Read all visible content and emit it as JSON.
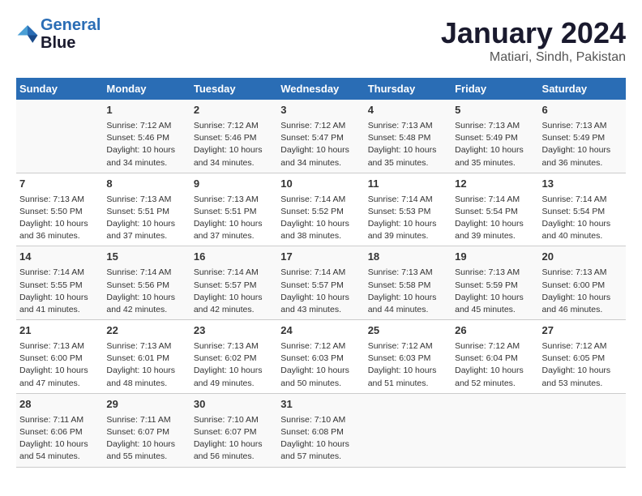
{
  "header": {
    "logo_line1": "General",
    "logo_line2": "Blue",
    "month": "January 2024",
    "location": "Matiari, Sindh, Pakistan"
  },
  "days_of_week": [
    "Sunday",
    "Monday",
    "Tuesday",
    "Wednesday",
    "Thursday",
    "Friday",
    "Saturday"
  ],
  "weeks": [
    [
      {
        "day": "",
        "info": ""
      },
      {
        "day": "1",
        "info": "Sunrise: 7:12 AM\nSunset: 5:46 PM\nDaylight: 10 hours\nand 34 minutes."
      },
      {
        "day": "2",
        "info": "Sunrise: 7:12 AM\nSunset: 5:46 PM\nDaylight: 10 hours\nand 34 minutes."
      },
      {
        "day": "3",
        "info": "Sunrise: 7:12 AM\nSunset: 5:47 PM\nDaylight: 10 hours\nand 34 minutes."
      },
      {
        "day": "4",
        "info": "Sunrise: 7:13 AM\nSunset: 5:48 PM\nDaylight: 10 hours\nand 35 minutes."
      },
      {
        "day": "5",
        "info": "Sunrise: 7:13 AM\nSunset: 5:49 PM\nDaylight: 10 hours\nand 35 minutes."
      },
      {
        "day": "6",
        "info": "Sunrise: 7:13 AM\nSunset: 5:49 PM\nDaylight: 10 hours\nand 36 minutes."
      }
    ],
    [
      {
        "day": "7",
        "info": "Sunrise: 7:13 AM\nSunset: 5:50 PM\nDaylight: 10 hours\nand 36 minutes."
      },
      {
        "day": "8",
        "info": "Sunrise: 7:13 AM\nSunset: 5:51 PM\nDaylight: 10 hours\nand 37 minutes."
      },
      {
        "day": "9",
        "info": "Sunrise: 7:13 AM\nSunset: 5:51 PM\nDaylight: 10 hours\nand 37 minutes."
      },
      {
        "day": "10",
        "info": "Sunrise: 7:14 AM\nSunset: 5:52 PM\nDaylight: 10 hours\nand 38 minutes."
      },
      {
        "day": "11",
        "info": "Sunrise: 7:14 AM\nSunset: 5:53 PM\nDaylight: 10 hours\nand 39 minutes."
      },
      {
        "day": "12",
        "info": "Sunrise: 7:14 AM\nSunset: 5:54 PM\nDaylight: 10 hours\nand 39 minutes."
      },
      {
        "day": "13",
        "info": "Sunrise: 7:14 AM\nSunset: 5:54 PM\nDaylight: 10 hours\nand 40 minutes."
      }
    ],
    [
      {
        "day": "14",
        "info": "Sunrise: 7:14 AM\nSunset: 5:55 PM\nDaylight: 10 hours\nand 41 minutes."
      },
      {
        "day": "15",
        "info": "Sunrise: 7:14 AM\nSunset: 5:56 PM\nDaylight: 10 hours\nand 42 minutes."
      },
      {
        "day": "16",
        "info": "Sunrise: 7:14 AM\nSunset: 5:57 PM\nDaylight: 10 hours\nand 42 minutes."
      },
      {
        "day": "17",
        "info": "Sunrise: 7:14 AM\nSunset: 5:57 PM\nDaylight: 10 hours\nand 43 minutes."
      },
      {
        "day": "18",
        "info": "Sunrise: 7:13 AM\nSunset: 5:58 PM\nDaylight: 10 hours\nand 44 minutes."
      },
      {
        "day": "19",
        "info": "Sunrise: 7:13 AM\nSunset: 5:59 PM\nDaylight: 10 hours\nand 45 minutes."
      },
      {
        "day": "20",
        "info": "Sunrise: 7:13 AM\nSunset: 6:00 PM\nDaylight: 10 hours\nand 46 minutes."
      }
    ],
    [
      {
        "day": "21",
        "info": "Sunrise: 7:13 AM\nSunset: 6:00 PM\nDaylight: 10 hours\nand 47 minutes."
      },
      {
        "day": "22",
        "info": "Sunrise: 7:13 AM\nSunset: 6:01 PM\nDaylight: 10 hours\nand 48 minutes."
      },
      {
        "day": "23",
        "info": "Sunrise: 7:13 AM\nSunset: 6:02 PM\nDaylight: 10 hours\nand 49 minutes."
      },
      {
        "day": "24",
        "info": "Sunrise: 7:12 AM\nSunset: 6:03 PM\nDaylight: 10 hours\nand 50 minutes."
      },
      {
        "day": "25",
        "info": "Sunrise: 7:12 AM\nSunset: 6:03 PM\nDaylight: 10 hours\nand 51 minutes."
      },
      {
        "day": "26",
        "info": "Sunrise: 7:12 AM\nSunset: 6:04 PM\nDaylight: 10 hours\nand 52 minutes."
      },
      {
        "day": "27",
        "info": "Sunrise: 7:12 AM\nSunset: 6:05 PM\nDaylight: 10 hours\nand 53 minutes."
      }
    ],
    [
      {
        "day": "28",
        "info": "Sunrise: 7:11 AM\nSunset: 6:06 PM\nDaylight: 10 hours\nand 54 minutes."
      },
      {
        "day": "29",
        "info": "Sunrise: 7:11 AM\nSunset: 6:07 PM\nDaylight: 10 hours\nand 55 minutes."
      },
      {
        "day": "30",
        "info": "Sunrise: 7:10 AM\nSunset: 6:07 PM\nDaylight: 10 hours\nand 56 minutes."
      },
      {
        "day": "31",
        "info": "Sunrise: 7:10 AM\nSunset: 6:08 PM\nDaylight: 10 hours\nand 57 minutes."
      },
      {
        "day": "",
        "info": ""
      },
      {
        "day": "",
        "info": ""
      },
      {
        "day": "",
        "info": ""
      }
    ]
  ]
}
